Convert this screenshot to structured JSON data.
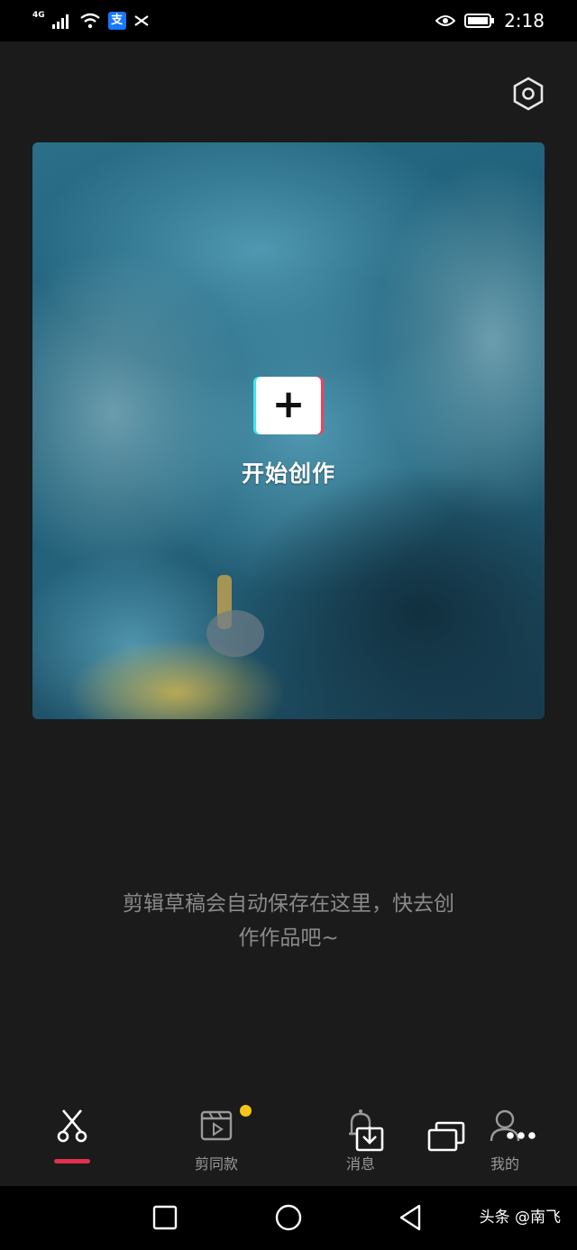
{
  "status_bar": {
    "network_label": "4G",
    "time": "2:18",
    "alipay_badge": "支",
    "icons": [
      "signal-icon",
      "wifi-icon",
      "alipay-icon",
      "capcut-icon",
      "eye-icon",
      "battery-icon"
    ]
  },
  "settings": {
    "icon": "settings-hexagon-icon"
  },
  "hero": {
    "create_label": "开始创作",
    "plus_glyph": "+"
  },
  "empty_hint": {
    "line1": "剪辑草稿会自动保存在这里，快去创",
    "line2": "作作品吧~"
  },
  "tabs": [
    {
      "label": "",
      "icon": "scissors-icon",
      "active": true
    },
    {
      "label": "剪同款",
      "icon": "clapperboard-icon",
      "badge": "dot"
    },
    {
      "label": "消息",
      "icon": "bell-icon"
    },
    {
      "label": "我的",
      "icon": "user-icon"
    }
  ],
  "floating_icons": [
    "download-icon",
    "multi-window-icon",
    "more-icon"
  ],
  "nav": {
    "buttons": [
      "recent-apps-icon",
      "home-icon",
      "back-icon"
    ]
  },
  "watermark": "头条 @南飞",
  "colors": {
    "accent_red": "#e0314d",
    "badge_yellow": "#f5c518",
    "background": "#1b1b1b"
  }
}
